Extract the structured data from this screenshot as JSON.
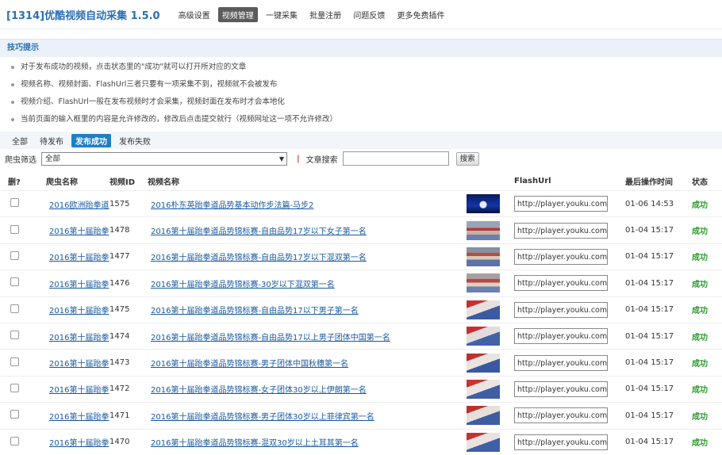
{
  "header": {
    "title": "[1314]优酷视频自动采集 1.5.0",
    "nav": [
      {
        "label": "高级设置",
        "active": false
      },
      {
        "label": "视频管理",
        "active": true
      },
      {
        "label": "一键采集",
        "active": false
      },
      {
        "label": "批量注册",
        "active": false
      },
      {
        "label": "问题反馈",
        "active": false
      },
      {
        "label": "更多免费插件",
        "active": false
      }
    ]
  },
  "tips": {
    "title": "技巧提示",
    "items": [
      "对于发布成功的视频，点击状态里的\"成功\"就可以打开所对应的文章",
      "视频名称、视频封面、FlashUrl三者只要有一项采集不到，视频就不会被发布",
      "视频介绍、FlashUrl一般在发布视频时才会采集，视频封面在发布时才会本地化",
      "当前页面的输入框里的内容是允许修改的，修改后点击提交就行（视频网址这一项不允许修改）"
    ]
  },
  "filter_tabs": [
    {
      "label": "全部",
      "active": false
    },
    {
      "label": "待发布",
      "active": false
    },
    {
      "label": "发布成功",
      "active": true
    },
    {
      "label": "发布失败",
      "active": false
    }
  ],
  "filter": {
    "spider_label": "爬虫筛选",
    "spider_value": "全部",
    "search_label": "文章搜索",
    "search_value": "",
    "search_button": "搜索"
  },
  "table": {
    "headers": [
      "删?",
      "爬虫名称",
      "视频ID",
      "视频名称",
      "",
      "FlashUrl",
      "最后操作时间",
      "状态"
    ],
    "rows": [
      {
        "spider": "2016欧洲跆拳道",
        "id": "1575",
        "name": "2016朴东英跆拳道品势基本动作步法篇-马步2",
        "url": "http://player.youku.com/",
        "time": "01-06 14:53",
        "status": "成功"
      },
      {
        "spider": "2016第十届跆拳",
        "id": "1478",
        "name": "2016第十届跆拳道品势锦标赛-自由品势17岁以下女子第一名",
        "url": "http://player.youku.com/",
        "time": "01-04 15:17",
        "status": "成功"
      },
      {
        "spider": "2016第十届跆拳",
        "id": "1477",
        "name": "2016第十届跆拳道品势锦标赛-自由品势17岁以下混双第一名",
        "url": "http://player.youku.com/",
        "time": "01-04 15:17",
        "status": "成功"
      },
      {
        "spider": "2016第十届跆拳",
        "id": "1476",
        "name": "2016第十届跆拳道品势锦标赛-30岁以下混双第一名",
        "url": "http://player.youku.com/",
        "time": "01-04 15:17",
        "status": "成功"
      },
      {
        "spider": "2016第十届跆拳",
        "id": "1475",
        "name": "2016第十届跆拳道品势锦标赛-自由品势17以下男子第一名",
        "url": "http://player.youku.com/",
        "time": "01-04 15:17",
        "status": "成功"
      },
      {
        "spider": "2016第十届跆拳",
        "id": "1474",
        "name": "2016第十届跆拳道品势锦标赛-自由品势17以上男子团体中国第一名",
        "url": "http://player.youku.com/",
        "time": "01-04 15:17",
        "status": "成功"
      },
      {
        "spider": "2016第十届跆拳",
        "id": "1473",
        "name": "2016第十届跆拳道品势锦标赛-男子团体中国秋穗第一名",
        "url": "http://player.youku.com/",
        "time": "01-04 15:17",
        "status": "成功"
      },
      {
        "spider": "2016第十届跆拳",
        "id": "1472",
        "name": "2016第十届跆拳道品势锦标赛-女子团体30岁以上伊朗第一名",
        "url": "http://player.youku.com/",
        "time": "01-04 15:17",
        "status": "成功"
      },
      {
        "spider": "2016第十届跆拳",
        "id": "1471",
        "name": "2016第十届跆拳道品势锦标赛-男子团体30岁以上菲律宾第一名",
        "url": "http://player.youku.com/",
        "time": "01-04 15:17",
        "status": "成功"
      },
      {
        "spider": "2016第十届跆拳",
        "id": "1470",
        "name": "2016第十届跆拳道品势锦标赛-混双30岁以上土耳其第一名",
        "url": "http://player.youku.com/",
        "time": "01-04 15:17",
        "status": "成功"
      }
    ]
  },
  "colors": {
    "accent": "#2a6fb5",
    "active_tab": "#1f7fc6",
    "success": "#2c9a2c"
  }
}
